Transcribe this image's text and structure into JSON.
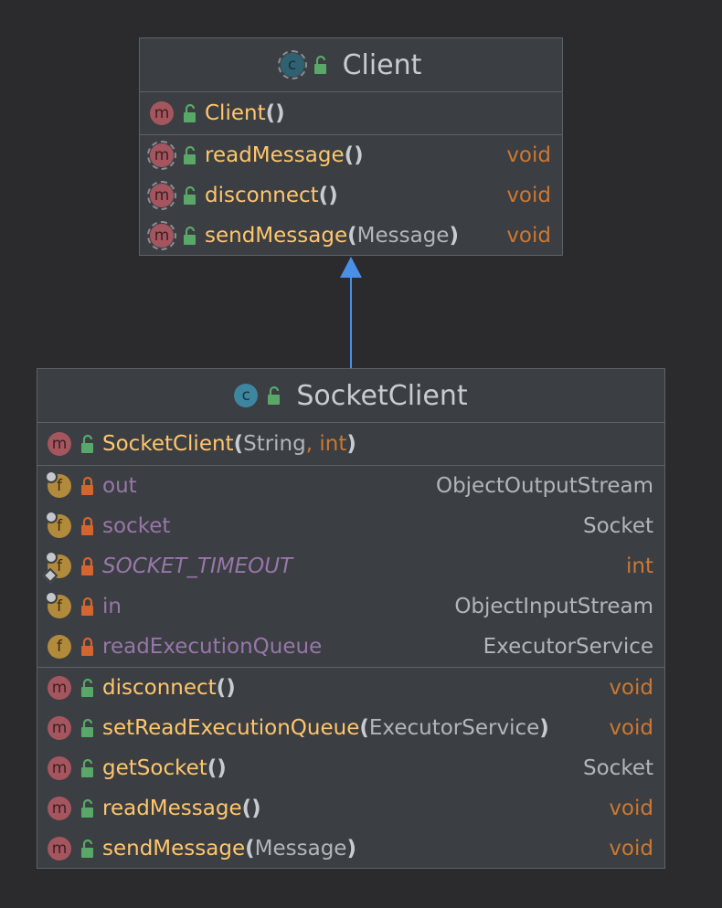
{
  "classes": {
    "client": {
      "name": "Client",
      "constructor": {
        "name": "Client",
        "open": "(",
        "close": ")"
      },
      "methods": [
        {
          "name": "readMessage",
          "params": "",
          "returns": "void"
        },
        {
          "name": "disconnect",
          "params": "",
          "returns": "void"
        },
        {
          "name": "sendMessage",
          "params": "Message",
          "returns": "void"
        }
      ]
    },
    "socket_client": {
      "name": "SocketClient",
      "constructor": {
        "name": "SocketClient",
        "param1": "String",
        "comma": ", ",
        "param2": "int"
      },
      "fields": [
        {
          "name": "out",
          "type": "ObjectOutputStream"
        },
        {
          "name": "socket",
          "type": "Socket"
        },
        {
          "name": "SOCKET_TIMEOUT",
          "type": "int"
        },
        {
          "name": "in",
          "type": "ObjectInputStream"
        },
        {
          "name": "readExecutionQueue",
          "type": "ExecutorService"
        }
      ],
      "methods": [
        {
          "name": "disconnect",
          "params": "",
          "returns": "void"
        },
        {
          "name": "setReadExecutionQueue",
          "params": "ExecutorService",
          "returns": "void"
        },
        {
          "name": "getSocket",
          "params": "",
          "returns": "Socket"
        },
        {
          "name": "readMessage",
          "params": "",
          "returns": "void"
        },
        {
          "name": "sendMessage",
          "params": "Message",
          "returns": "void"
        }
      ]
    }
  },
  "icons": {
    "class": "class-icon",
    "method": "method-icon",
    "field": "field-icon",
    "public": "unlocked-icon",
    "private": "locked-icon",
    "badge_m": "m",
    "badge_f": "f",
    "badge_c": "c"
  },
  "colors": {
    "background": "#2b2b2d",
    "box": "#3b3e42",
    "border": "#5e6266",
    "method_name": "#ffc66d",
    "field_name": "#9876aa",
    "keyword": "#cc7832",
    "arrow": "#4a8fe8",
    "public_lock": "#59a869",
    "private_lock": "#d4652f"
  }
}
